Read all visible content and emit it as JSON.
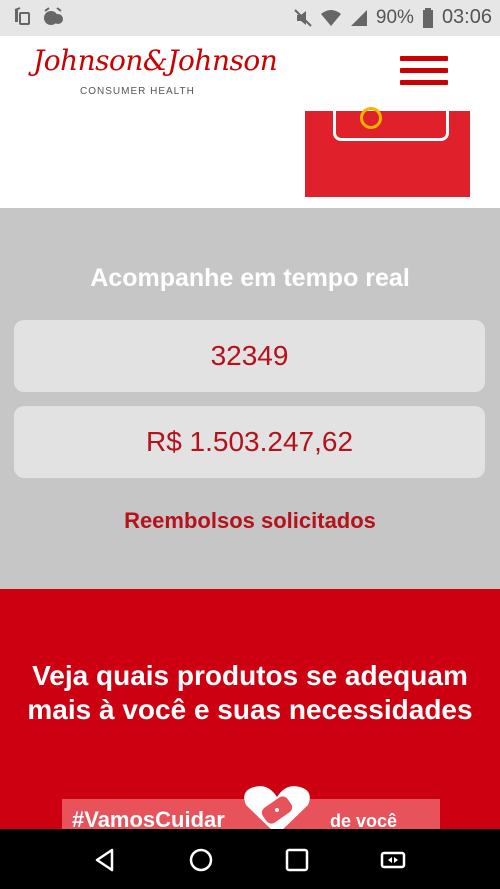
{
  "status_bar": {
    "battery": "90%",
    "time": "03:06",
    "icons": [
      "wireless-charging-icon",
      "alarm-icon",
      "mute-icon",
      "wifi-icon",
      "signal-icon",
      "battery-icon"
    ]
  },
  "header": {
    "brand_name": "Johnson&Johnson",
    "brand_subtitle": "CONSUMER HEALTH",
    "menu_icon": "hamburger-menu-icon"
  },
  "tracker": {
    "heading": "Acompanhe em tempo real",
    "count": "32349",
    "amount": "R$ 1.503.247,62",
    "caption": "Reembolsos solicitados"
  },
  "products": {
    "heading": "Veja quais produtos se adequam mais à você e suas necessidades",
    "banner_tag": "#VamosCuidar",
    "banner_rest": "de você"
  },
  "nav": {
    "icons": [
      "back-icon",
      "home-icon",
      "recents-icon",
      "rotate-icon"
    ]
  },
  "colors": {
    "brand_red": "#cc0000",
    "text_red": "#b5121b",
    "gray_bg": "#c6c6c6"
  }
}
